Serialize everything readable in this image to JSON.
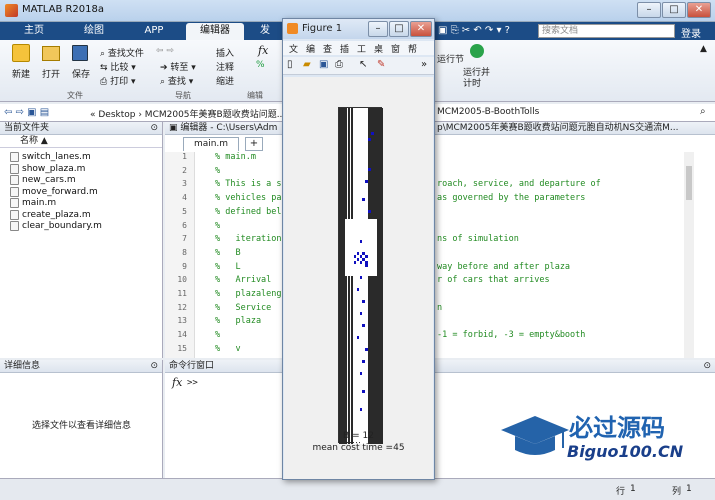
{
  "window": {
    "title": "MATLAB R2018a",
    "min": "–",
    "max": "□",
    "close": "✕"
  },
  "tabs": [
    "主页",
    "绘图",
    "APP",
    "编辑器",
    "发"
  ],
  "search": {
    "placeholder": "搜索文档"
  },
  "login": "登录",
  "ribbon": {
    "new": "新建",
    "open": "打开",
    "save": "保存",
    "find_files": "查找文件",
    "compare": "比较",
    "print": "打印",
    "goto": "转至",
    "find": "查找",
    "insert": "插入",
    "comment": "注释",
    "indent": "缩进",
    "run_section": "运行节",
    "run_time": "运行并\n计时",
    "groups": {
      "file": "文件",
      "nav": "导航",
      "edit": "编辑"
    }
  },
  "address": {
    "path": "« Desktop › MCM2005年美赛B题收费站问题...",
    "path_right": "MCM2005-B-BoothTolls"
  },
  "left_panel": {
    "title": "当前文件夹",
    "col": "名称",
    "sort": "▲",
    "files": [
      "switch_lanes.m",
      "show_plaza.m",
      "new_cars.m",
      "move_forward.m",
      "main.m",
      "create_plaza.m",
      "clear_boundary.m"
    ]
  },
  "detail": {
    "title": "详细信息",
    "hint": "选择文件以查看详细信息"
  },
  "editor": {
    "title": "编辑器 - C:\\Users\\Adm",
    "title_right": "p\\MCM2005年美赛B题收费站问题元胞自动机NS交通流M...",
    "tab": "main.m",
    "add": "+",
    "lines": [
      {
        "n": "1",
        "t": "% main.m"
      },
      {
        "n": "2",
        "t": "%"
      },
      {
        "n": "3",
        "t": "% This is a s"
      },
      {
        "n": "4",
        "t": "% vehicles pa"
      },
      {
        "n": "5",
        "t": "% defined bel"
      },
      {
        "n": "6",
        "t": "%"
      },
      {
        "n": "7",
        "t": "%   iteration"
      },
      {
        "n": "8",
        "t": "%   B"
      },
      {
        "n": "9",
        "t": "%   L"
      },
      {
        "n": "10",
        "t": "%   Arrival"
      },
      {
        "n": "11",
        "t": "%   plazaleng"
      },
      {
        "n": "12",
        "t": "%   Service"
      },
      {
        "n": "13",
        "t": "%   plaza"
      },
      {
        "n": "14",
        "t": "%"
      },
      {
        "n": "15",
        "t": "%   v"
      }
    ],
    "right": [
      {
        "n": "3",
        "t": "roach, service, and departure of"
      },
      {
        "n": "4",
        "t": "as governed by the parameters"
      },
      {
        "n": "7",
        "t": "ns of simulation"
      },
      {
        "n": "9",
        "t": "way before and after plaza"
      },
      {
        "n": "10",
        "t": "r of cars that arrives"
      },
      {
        "n": "12",
        "t": "n"
      },
      {
        "n": "14",
        "t": "-1 = forbid, -3 = empty&booth"
      }
    ]
  },
  "cmd": {
    "title": "命令行窗口",
    "fx": "fx",
    "prompt": ">>"
  },
  "status": {
    "row_label": "行",
    "row": "1",
    "col_label": "列",
    "col": "1"
  },
  "figure": {
    "title": "Figure 1",
    "menu": [
      "文",
      "编",
      "查",
      "插",
      "工",
      "桌",
      "窗",
      "帮"
    ],
    "label_b": "B = 12",
    "label_cost": "mean cost time =45"
  },
  "watermark": {
    "text": "必过源码",
    "url": "Biguo100.CN"
  },
  "colors": {
    "accent": "#1c4c86",
    "code_green": "#228b22",
    "car": "#1010c0"
  }
}
